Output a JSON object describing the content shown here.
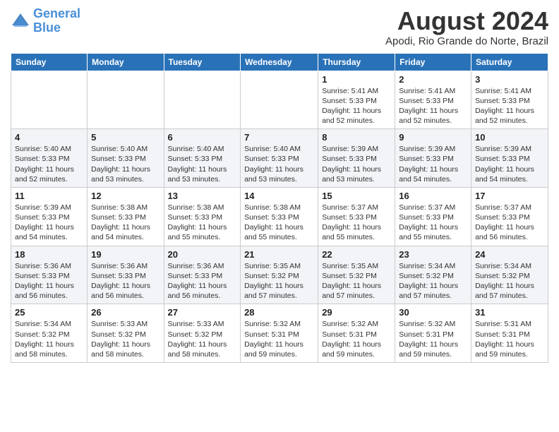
{
  "header": {
    "logo_line1": "General",
    "logo_line2": "Blue",
    "month_title": "August 2024",
    "location": "Apodi, Rio Grande do Norte, Brazil"
  },
  "weekdays": [
    "Sunday",
    "Monday",
    "Tuesday",
    "Wednesday",
    "Thursday",
    "Friday",
    "Saturday"
  ],
  "weeks": [
    [
      {
        "day": "",
        "info": ""
      },
      {
        "day": "",
        "info": ""
      },
      {
        "day": "",
        "info": ""
      },
      {
        "day": "",
        "info": ""
      },
      {
        "day": "1",
        "info": "Sunrise: 5:41 AM\nSunset: 5:33 PM\nDaylight: 11 hours\nand 52 minutes."
      },
      {
        "day": "2",
        "info": "Sunrise: 5:41 AM\nSunset: 5:33 PM\nDaylight: 11 hours\nand 52 minutes."
      },
      {
        "day": "3",
        "info": "Sunrise: 5:41 AM\nSunset: 5:33 PM\nDaylight: 11 hours\nand 52 minutes."
      }
    ],
    [
      {
        "day": "4",
        "info": "Sunrise: 5:40 AM\nSunset: 5:33 PM\nDaylight: 11 hours\nand 52 minutes."
      },
      {
        "day": "5",
        "info": "Sunrise: 5:40 AM\nSunset: 5:33 PM\nDaylight: 11 hours\nand 53 minutes."
      },
      {
        "day": "6",
        "info": "Sunrise: 5:40 AM\nSunset: 5:33 PM\nDaylight: 11 hours\nand 53 minutes."
      },
      {
        "day": "7",
        "info": "Sunrise: 5:40 AM\nSunset: 5:33 PM\nDaylight: 11 hours\nand 53 minutes."
      },
      {
        "day": "8",
        "info": "Sunrise: 5:39 AM\nSunset: 5:33 PM\nDaylight: 11 hours\nand 53 minutes."
      },
      {
        "day": "9",
        "info": "Sunrise: 5:39 AM\nSunset: 5:33 PM\nDaylight: 11 hours\nand 54 minutes."
      },
      {
        "day": "10",
        "info": "Sunrise: 5:39 AM\nSunset: 5:33 PM\nDaylight: 11 hours\nand 54 minutes."
      }
    ],
    [
      {
        "day": "11",
        "info": "Sunrise: 5:39 AM\nSunset: 5:33 PM\nDaylight: 11 hours\nand 54 minutes."
      },
      {
        "day": "12",
        "info": "Sunrise: 5:38 AM\nSunset: 5:33 PM\nDaylight: 11 hours\nand 54 minutes."
      },
      {
        "day": "13",
        "info": "Sunrise: 5:38 AM\nSunset: 5:33 PM\nDaylight: 11 hours\nand 55 minutes."
      },
      {
        "day": "14",
        "info": "Sunrise: 5:38 AM\nSunset: 5:33 PM\nDaylight: 11 hours\nand 55 minutes."
      },
      {
        "day": "15",
        "info": "Sunrise: 5:37 AM\nSunset: 5:33 PM\nDaylight: 11 hours\nand 55 minutes."
      },
      {
        "day": "16",
        "info": "Sunrise: 5:37 AM\nSunset: 5:33 PM\nDaylight: 11 hours\nand 55 minutes."
      },
      {
        "day": "17",
        "info": "Sunrise: 5:37 AM\nSunset: 5:33 PM\nDaylight: 11 hours\nand 56 minutes."
      }
    ],
    [
      {
        "day": "18",
        "info": "Sunrise: 5:36 AM\nSunset: 5:33 PM\nDaylight: 11 hours\nand 56 minutes."
      },
      {
        "day": "19",
        "info": "Sunrise: 5:36 AM\nSunset: 5:33 PM\nDaylight: 11 hours\nand 56 minutes."
      },
      {
        "day": "20",
        "info": "Sunrise: 5:36 AM\nSunset: 5:33 PM\nDaylight: 11 hours\nand 56 minutes."
      },
      {
        "day": "21",
        "info": "Sunrise: 5:35 AM\nSunset: 5:32 PM\nDaylight: 11 hours\nand 57 minutes."
      },
      {
        "day": "22",
        "info": "Sunrise: 5:35 AM\nSunset: 5:32 PM\nDaylight: 11 hours\nand 57 minutes."
      },
      {
        "day": "23",
        "info": "Sunrise: 5:34 AM\nSunset: 5:32 PM\nDaylight: 11 hours\nand 57 minutes."
      },
      {
        "day": "24",
        "info": "Sunrise: 5:34 AM\nSunset: 5:32 PM\nDaylight: 11 hours\nand 57 minutes."
      }
    ],
    [
      {
        "day": "25",
        "info": "Sunrise: 5:34 AM\nSunset: 5:32 PM\nDaylight: 11 hours\nand 58 minutes."
      },
      {
        "day": "26",
        "info": "Sunrise: 5:33 AM\nSunset: 5:32 PM\nDaylight: 11 hours\nand 58 minutes."
      },
      {
        "day": "27",
        "info": "Sunrise: 5:33 AM\nSunset: 5:32 PM\nDaylight: 11 hours\nand 58 minutes."
      },
      {
        "day": "28",
        "info": "Sunrise: 5:32 AM\nSunset: 5:31 PM\nDaylight: 11 hours\nand 59 minutes."
      },
      {
        "day": "29",
        "info": "Sunrise: 5:32 AM\nSunset: 5:31 PM\nDaylight: 11 hours\nand 59 minutes."
      },
      {
        "day": "30",
        "info": "Sunrise: 5:32 AM\nSunset: 5:31 PM\nDaylight: 11 hours\nand 59 minutes."
      },
      {
        "day": "31",
        "info": "Sunrise: 5:31 AM\nSunset: 5:31 PM\nDaylight: 11 hours\nand 59 minutes."
      }
    ]
  ]
}
